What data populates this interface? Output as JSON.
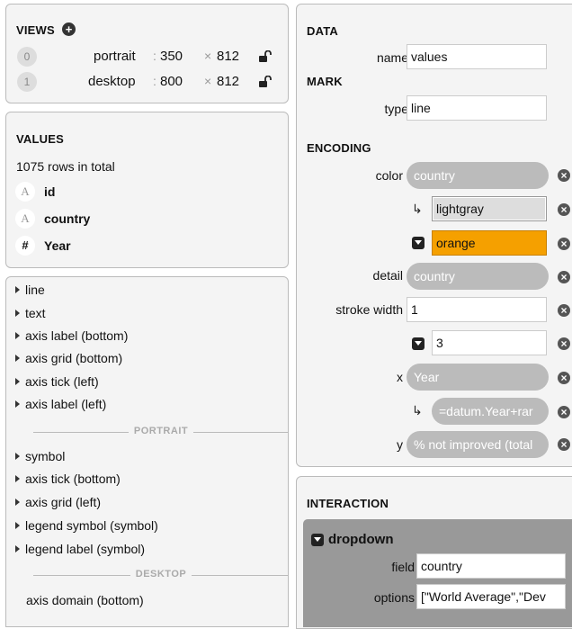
{
  "views": {
    "title": "VIEWS",
    "add_icon": "plus-circle-icon",
    "items": [
      {
        "index": "0",
        "name": "portrait",
        "width": "350",
        "height": "812",
        "lock_icon": "unlock-icon"
      },
      {
        "index": "1",
        "name": "desktop",
        "width": "800",
        "height": "812",
        "lock_icon": "unlock-icon"
      }
    ],
    "colon": ":",
    "times": "×"
  },
  "values": {
    "title": "VALUES",
    "summary": "1075 rows in total",
    "fields": [
      {
        "type_glyph": "A",
        "name": "id"
      },
      {
        "type_glyph": "A",
        "name": "country"
      },
      {
        "type_glyph": "#",
        "name": "Year"
      }
    ]
  },
  "layers": {
    "group1": [
      "line",
      "text",
      "axis label (bottom)",
      "axis grid (bottom)",
      "axis tick (left)",
      "axis label (left)"
    ],
    "sep1": "PORTRAIT",
    "group2": [
      "symbol",
      "axis tick (bottom)",
      "axis grid (left)",
      "legend symbol (symbol)",
      "legend label (symbol)"
    ],
    "sep2": "DESKTOP",
    "group3": [
      "axis domain (bottom)"
    ]
  },
  "data": {
    "title": "DATA",
    "name_label": "name",
    "name_value": "values"
  },
  "mark": {
    "title": "MARK",
    "type_label": "type",
    "type_value": "line"
  },
  "encoding": {
    "title": "ENCODING",
    "color_label": "color",
    "color_field": "country",
    "color_default": "lightgray",
    "color_selected": "orange",
    "detail_label": "detail",
    "detail_field": "country",
    "stroke_label": "stroke width",
    "stroke_default": "1",
    "stroke_selected": "3",
    "x_label": "x",
    "x_field": "Year",
    "x_expr": "=datum.Year+rar",
    "y_label": "y",
    "y_field": "% not improved (total",
    "remove_icon": "remove-icon",
    "arrow": "↳",
    "orange_hex": "#f5a000"
  },
  "interaction": {
    "title": "INTERACTION",
    "widget": "dropdown",
    "field_label": "field",
    "field_value": "country",
    "options_label": "options",
    "options_value": "[\"World Average\",\"Dev"
  }
}
